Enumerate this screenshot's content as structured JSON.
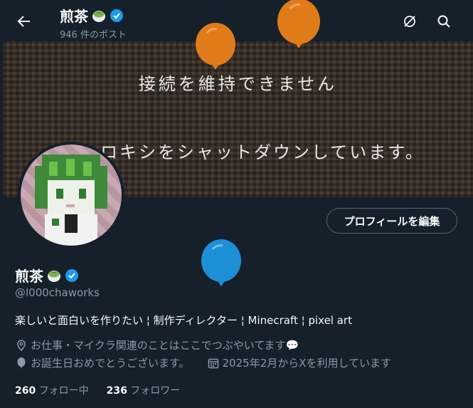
{
  "header": {
    "name": "煎茶",
    "post_count": "946 件のポスト"
  },
  "banner": {
    "line1": "接続を維持できません",
    "line2": "ッロキシをシャットダウンしています。"
  },
  "profile": {
    "name": "煎茶",
    "handle": "@l000chaworks",
    "bio": "楽しいと面白いを作りたい ¦ 制作ディレクター ¦ Minecraft ¦ pixel art",
    "location": "お仕事・マイクラ関連のことはここでつぶやいてます💬",
    "birthday": "お誕生日おめでとうございます。",
    "joined": "2025年2月からXを利用しています",
    "edit_label": "プロフィールを編集",
    "following_count": "260",
    "following_label": "フォロー中",
    "followers_count": "236",
    "followers_label": "フォロワー"
  },
  "colors": {
    "background": "#15202b",
    "secondary_text": "#8b98a5",
    "verified": "#1d9bf0",
    "balloon_orange": "#e07b1a",
    "balloon_blue": "#1d8fd6"
  },
  "icons": [
    "back-arrow-icon",
    "verified-icon",
    "tea-cup-icon",
    "refresh-off-icon",
    "search-icon",
    "location-icon",
    "balloon-icon",
    "calendar-icon"
  ]
}
